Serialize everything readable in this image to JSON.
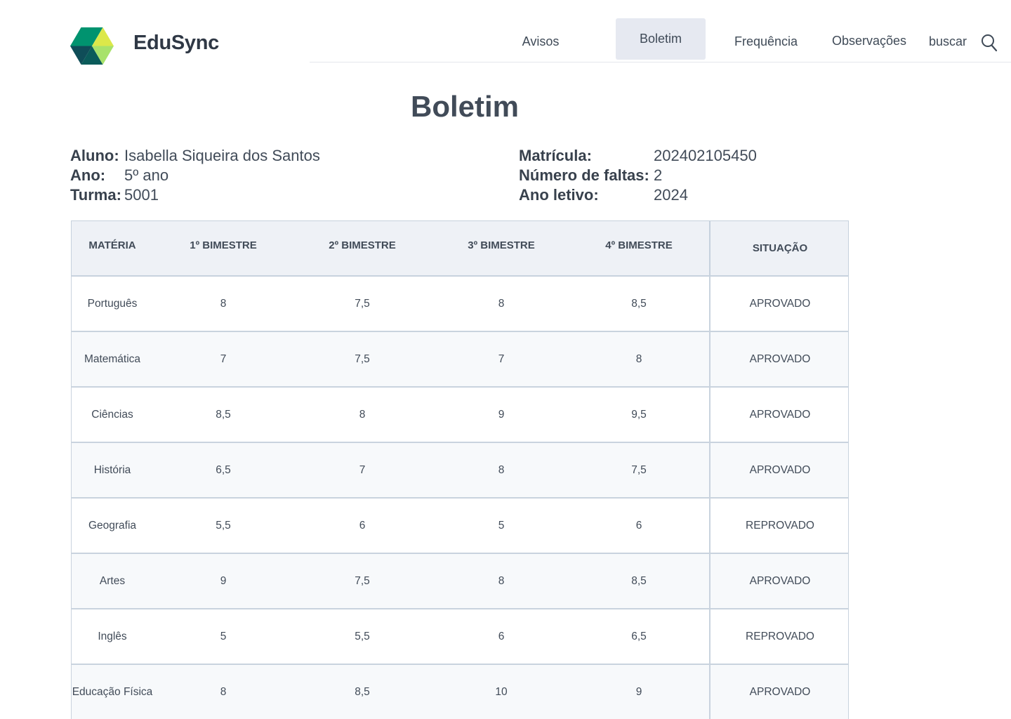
{
  "app": {
    "brand": "EduSync"
  },
  "nav": {
    "items": [
      "Avisos",
      "Boletim",
      "Frequência",
      "Observações",
      "buscar"
    ],
    "active": "Boletim"
  },
  "page": {
    "title": "Boletim"
  },
  "student": {
    "labels": {
      "aluno": "Aluno:",
      "ano": "Ano:",
      "turma": "Turma:",
      "matricula": "Matrícula:",
      "faltas": "Número de faltas:",
      "ano_letivo": "Ano letivo:"
    },
    "aluno": "Isabella Siqueira dos Santos",
    "ano": "5º ano",
    "turma": "5001",
    "matricula": "202402105450",
    "faltas": "2",
    "ano_letivo": "2024"
  },
  "table": {
    "headers": [
      "MATÉRIA",
      "1º BIMESTRE",
      "2º BIMESTRE",
      "3º BIMESTRE",
      "4º BIMESTRE",
      "SITUAÇÃO"
    ],
    "rows": [
      {
        "materia": "Português",
        "b1": "8",
        "b2": "7,5",
        "b3": "8",
        "b4": "8,5",
        "situacao": "APROVADO"
      },
      {
        "materia": "Matemática",
        "b1": "7",
        "b2": "7,5",
        "b3": "7",
        "b4": "8",
        "situacao": "APROVADO"
      },
      {
        "materia": "Ciências",
        "b1": "8,5",
        "b2": "8",
        "b3": "9",
        "b4": "9,5",
        "situacao": "APROVADO"
      },
      {
        "materia": "História",
        "b1": "6,5",
        "b2": "7",
        "b3": "8",
        "b4": "7,5",
        "situacao": "APROVADO"
      },
      {
        "materia": "Geografia",
        "b1": "5,5",
        "b2": "6",
        "b3": "5",
        "b4": "6",
        "situacao": "REPROVADO"
      },
      {
        "materia": "Artes",
        "b1": "9",
        "b2": "7,5",
        "b3": "8",
        "b4": "8,5",
        "situacao": "APROVADO"
      },
      {
        "materia": "Inglês",
        "b1": "5",
        "b2": "5,5",
        "b3": "6",
        "b4": "6,5",
        "situacao": "REPROVADO"
      },
      {
        "materia": "Educação Física",
        "b1": "8",
        "b2": "8,5",
        "b3": "10",
        "b4": "9",
        "situacao": "APROVADO"
      }
    ]
  },
  "colors": {
    "header_bg": "#eef1f6",
    "nav_active_bg": "#e6e9f1",
    "logo_teal": "#008a6e",
    "logo_dark": "#0f4a55",
    "logo_lime": "#c9e84a"
  },
  "icons": {
    "logo": "hexagon-cube-logo",
    "search": "search-icon"
  }
}
